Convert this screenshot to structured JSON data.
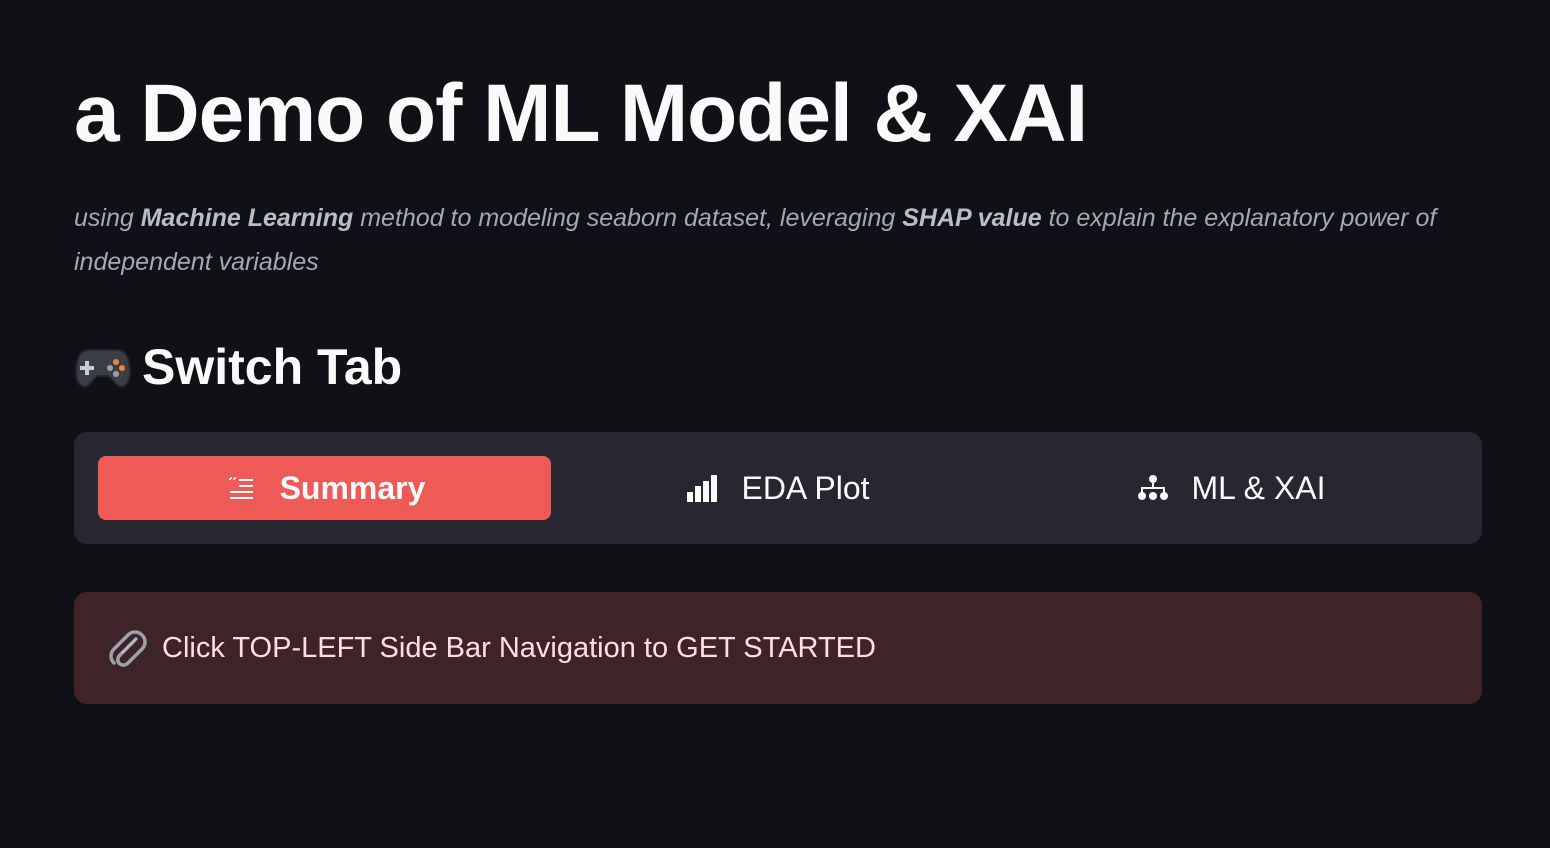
{
  "header": {
    "title": "a Demo of ML Model & XAI",
    "subtitle_part1": "using ",
    "subtitle_bold1": "Machine Learning",
    "subtitle_part2": " method to modeling seaborn dataset, leveraging ",
    "subtitle_bold2": "SHAP value",
    "subtitle_part3": " to explain the explanatory power of independent variables"
  },
  "section": {
    "icon": "gamepad-icon",
    "heading": "Switch Tab"
  },
  "tabs": [
    {
      "label": "Summary",
      "icon": "list-icon",
      "active": true
    },
    {
      "label": "EDA Plot",
      "icon": "bar-chart-icon",
      "active": false
    },
    {
      "label": "ML & XAI",
      "icon": "hierarchy-icon",
      "active": false
    }
  ],
  "alert": {
    "icon": "paperclip-icon",
    "message": "Click TOP-LEFT Side Bar Navigation to GET STARTED"
  },
  "colors": {
    "background": "#0f1116",
    "accent": "#ee5a55",
    "tab_bar": "#262730",
    "alert_background": "#3e2428"
  }
}
